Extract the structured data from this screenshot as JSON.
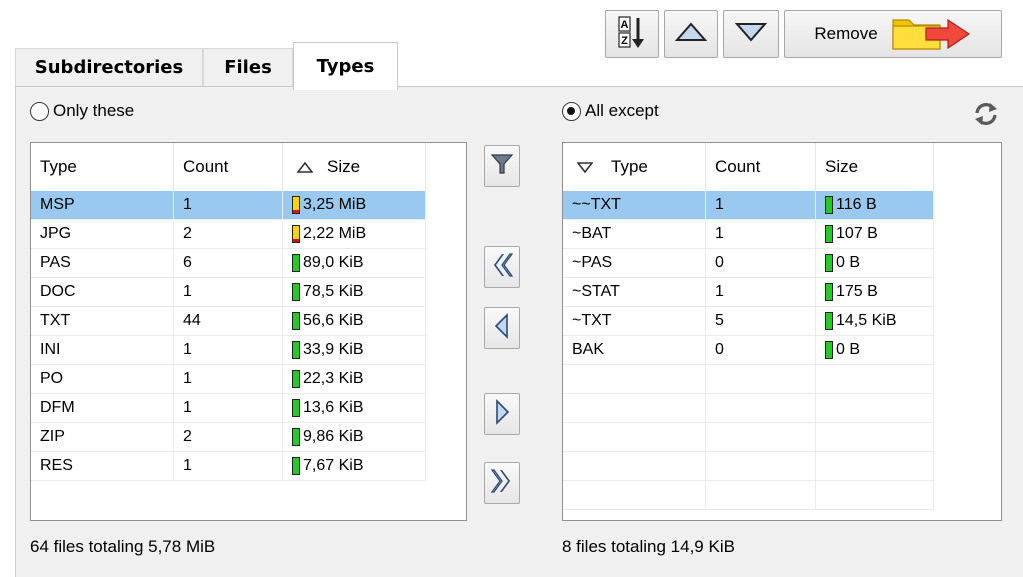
{
  "toolbar": {
    "sort_icon": "sort-alpha-icon",
    "up_icon": "move-up-icon",
    "down_icon": "move-down-icon",
    "remove_label": "Remove",
    "remove_icon": "folder-arrow-icon"
  },
  "tabs": [
    {
      "label": "Subdirectories",
      "active": false
    },
    {
      "label": "Files",
      "active": false
    },
    {
      "label": "Types",
      "active": true
    }
  ],
  "left": {
    "radio_label": "Only these",
    "radio_checked": false,
    "columns": [
      "Type",
      "Count",
      "Size"
    ],
    "sort_column": "Size",
    "sort_direction": "ascending",
    "rows": [
      {
        "type": "MSP",
        "count": "1",
        "size": "3,25 MiB",
        "bar": "#ffd400",
        "selected": true
      },
      {
        "type": "JPG",
        "count": "2",
        "size": "2,22 MiB",
        "bar": "#ffd400",
        "selected": false
      },
      {
        "type": "PAS",
        "count": "6",
        "size": "89,0 KiB",
        "bar": "#22cc22",
        "selected": false
      },
      {
        "type": "DOC",
        "count": "1",
        "size": "78,5 KiB",
        "bar": "#22cc22",
        "selected": false
      },
      {
        "type": "TXT",
        "count": "44",
        "size": "56,6 KiB",
        "bar": "#22cc22",
        "selected": false
      },
      {
        "type": "INI",
        "count": "1",
        "size": "33,9 KiB",
        "bar": "#22cc22",
        "selected": false
      },
      {
        "type": "PO",
        "count": "1",
        "size": "22,3 KiB",
        "bar": "#22cc22",
        "selected": false
      },
      {
        "type": "DFM",
        "count": "1",
        "size": "13,6 KiB",
        "bar": "#22cc22",
        "selected": false
      },
      {
        "type": "ZIP",
        "count": "2",
        "size": "9,86 KiB",
        "bar": "#22cc22",
        "selected": false
      },
      {
        "type": "RES",
        "count": "1",
        "size": "7,67 KiB",
        "bar": "#22cc22",
        "selected": false
      }
    ],
    "status": "64 files totaling 5,78 MiB"
  },
  "middle": {
    "filter_icon": "filter-icon",
    "move_all_left_icon": "double-chevron-left-icon",
    "move_left_icon": "chevron-left-icon",
    "move_right_icon": "chevron-right-icon",
    "move_all_right_icon": "double-chevron-right-icon"
  },
  "right": {
    "radio_label": "All except",
    "radio_checked": true,
    "refresh_icon": "refresh-icon",
    "columns": [
      "Type",
      "Count",
      "Size"
    ],
    "sort_column": "Type",
    "sort_direction": "descending",
    "rows": [
      {
        "type": "~~TXT",
        "count": "1",
        "size": "116 B",
        "bar": "#22cc22",
        "selected": true
      },
      {
        "type": "~BAT",
        "count": "1",
        "size": "107 B",
        "bar": "#22cc22",
        "selected": false
      },
      {
        "type": "~PAS",
        "count": "0",
        "size": "0 B",
        "bar": "#22cc22",
        "selected": false
      },
      {
        "type": "~STAT",
        "count": "1",
        "size": "175 B",
        "bar": "#22cc22",
        "selected": false
      },
      {
        "type": "~TXT",
        "count": "5",
        "size": "14,5 KiB",
        "bar": "#22cc22",
        "selected": false
      },
      {
        "type": "BAK",
        "count": "0",
        "size": "0 B",
        "bar": "#22cc22",
        "selected": false
      }
    ],
    "status": "8 files totaling 14,9 KiB"
  }
}
